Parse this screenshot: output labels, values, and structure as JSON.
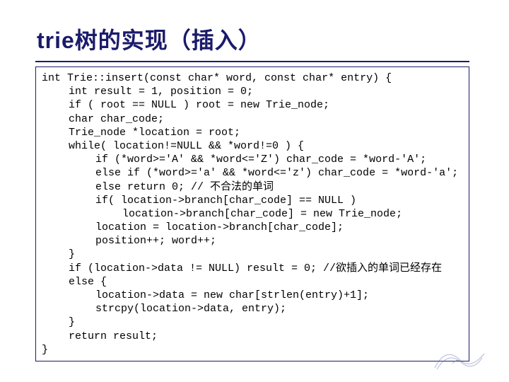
{
  "title": "trie树的实现（插入）",
  "code": {
    "l00": "int Trie::insert(const char* word, const char* entry) {",
    "l01": "int result = 1, position = 0;",
    "l02": "if ( root == NULL ) root = new Trie_node;",
    "l03": "char char_code;",
    "l04": "Trie_node *location = root;",
    "l05": "while( location!=NULL && *word!=0 ) {",
    "l06": "if (*word>='A' && *word<='Z') char_code = *word-'A';",
    "l07": "else if (*word>='a' && *word<='z') char_code = *word-'a';",
    "l08": "else return 0; // 不合法的单词",
    "l09": "if( location->branch[char_code] == NULL )",
    "l10": "location->branch[char_code] = new Trie_node;",
    "l11": "location = location->branch[char_code];",
    "l12": "position++; word++;",
    "l13": "}",
    "l14": "if (location->data != NULL) result = 0; //欲插入的单词已经存在",
    "l15": "else {",
    "l16": "location->data = new char[strlen(entry)+1];",
    "l17": "strcpy(location->data, entry);",
    "l18": "}",
    "l19": "return result;",
    "l20": "}"
  }
}
